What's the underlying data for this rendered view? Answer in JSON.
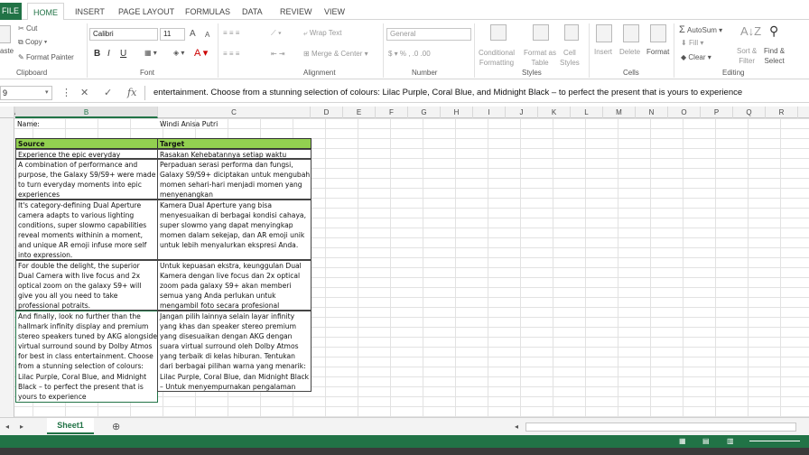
{
  "ribbon_tabs": [
    "FILE",
    "HOME",
    "INSERT",
    "PAGE LAYOUT",
    "FORMULAS",
    "DATA",
    "REVIEW",
    "VIEW"
  ],
  "clipboard": {
    "paste": "aste",
    "cut": "Cut",
    "copy": "Copy",
    "format_painter": "Format Painter",
    "label": "Clipboard"
  },
  "font": {
    "name": "Calibri",
    "size": "11",
    "label": "Font",
    "bold": "B",
    "italic": "I",
    "underline": "U",
    "grow": "A",
    "shrink": "A"
  },
  "alignment": {
    "wrap": "Wrap Text",
    "merge": "Merge & Center",
    "label": "Alignment"
  },
  "number": {
    "format": "General",
    "label": "Number"
  },
  "styles": {
    "conditional": "Conditional\nFormatting",
    "format_table": "Format as\nTable",
    "cell_styles": "Cell\nStyles",
    "label": "Styles"
  },
  "cells": {
    "insert": "Insert",
    "delete": "Delete",
    "format": "Format",
    "label": "Cells"
  },
  "editing": {
    "autosum": "AutoSum",
    "fill": "Fill",
    "clear": "Clear",
    "sort": "Sort &\nFilter",
    "find": "Find &\nSelect",
    "label": "Editing"
  },
  "formula_bar": {
    "name_box": "9",
    "cancel": "✕",
    "enter": "✓",
    "fx": "fx",
    "formula": "entertainment. Choose from a stunning selection of colours: Lilac Purple, Coral Blue, and Midnight Black – to perfect the present that is yours to experience"
  },
  "columns": [
    "A",
    "B",
    "C",
    "D",
    "E",
    "F",
    "G",
    "H",
    "I",
    "J",
    "K",
    "L",
    "M",
    "N",
    "O",
    "P",
    "Q",
    "R"
  ],
  "sheet": {
    "name_label": "Name:",
    "name_value": "Windi Anisa Putri",
    "col_source": "Source",
    "col_target": "Target",
    "rows": [
      {
        "source": "Experience the epic everyday",
        "target": "Rasakan Kehebatannya setiap waktu"
      },
      {
        "source": "A combination of performance and purpose, the Galaxy S9/S9+ were made to turn everyday moments into epic experiences",
        "target": "Perpaduan serasi performa dan fungsi, Galaxy S9/S9+ diciptakan untuk mengubah momen sehari-hari menjadi momen yang menyenangkan"
      },
      {
        "source": "It's category-defining Dual Aperture camera adapts to various lighting conditions, super slowmo capabilities reveal moments withinin a moment, and unique AR emoji infuse more self into expression.",
        "target": "Kamera Dual Aperture yang bisa menyesuaikan di berbagai kondisi cahaya, super slowmo yang dapat menyingkap momen dalam sekejap, dan AR emoji unik untuk lebih menyalurkan ekspresi Anda."
      },
      {
        "source": "For double the delight, the superior Dual Camera with live focus and 2x optical zoom on the galaxy S9+ will give you all you need to take professional potraits.",
        "target": "Untuk kepuasan ekstra, keunggulan Dual Kamera dengan live focus dan 2x optical zoom pada galaxy S9+ akan memberi semua yang Anda perlukan untuk mengambil foto secara profesional"
      },
      {
        "source": "And finally, look no further than the hallmark infinity display and premium stereo speakers tuned by AKG alongside virtual surround sound by Dolby Atmos for best in class entertainment. Choose from a stunning selection of colours: Lilac Purple, Coral Blue, and Midnight Black – to perfect the present that is yours to experience",
        "target": "Jangan pilih lainnya selain layar infinity yang khas dan speaker stereo premium yang disesuaikan dengan AKG dengan suara virtual surround oleh Dolby Atmos yang terbaik di kelas hiburan. Tentukan dari berbagai pilihan warna yang menarik: Lilac Purple, Coral Blue, dan Midnight Black – Untuk menyempurnakan pengalaman"
      }
    ]
  },
  "sheet_tab": "Sheet1",
  "add_sheet": "⊕",
  "colors": {
    "accent": "#217346",
    "header_fill": "#92d050"
  }
}
